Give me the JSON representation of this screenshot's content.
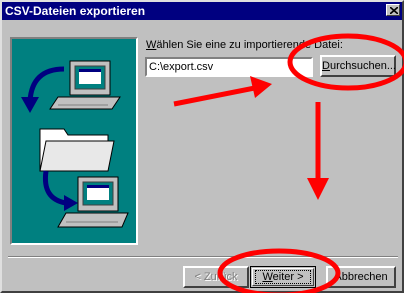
{
  "window": {
    "title": "CSV-Dateien exportieren",
    "close_icon": "close-x-icon"
  },
  "form": {
    "label_mnemonic": "W",
    "label_rest": "ählen Sie eine zu importierende Datei:",
    "file_path": "C:\\export.csv",
    "browse_mnemonic": "D",
    "browse_rest": "urchsuchen..."
  },
  "footer": {
    "back_label": "< Zurück",
    "next_mnemonic": "W",
    "next_rest": "eiter >",
    "cancel_label": "Abbrechen"
  },
  "illustration": {
    "icons": [
      "computer-icon",
      "folder-icon",
      "computer-icon",
      "arrow-down-icon",
      "arrow-curved-icon"
    ]
  },
  "annotations": {
    "colors": {
      "markup": "#ff0000",
      "teal": "#008080",
      "title_bar": "#000080"
    },
    "icons": [
      "arrow-icon",
      "ellipse-highlight-icon"
    ]
  }
}
